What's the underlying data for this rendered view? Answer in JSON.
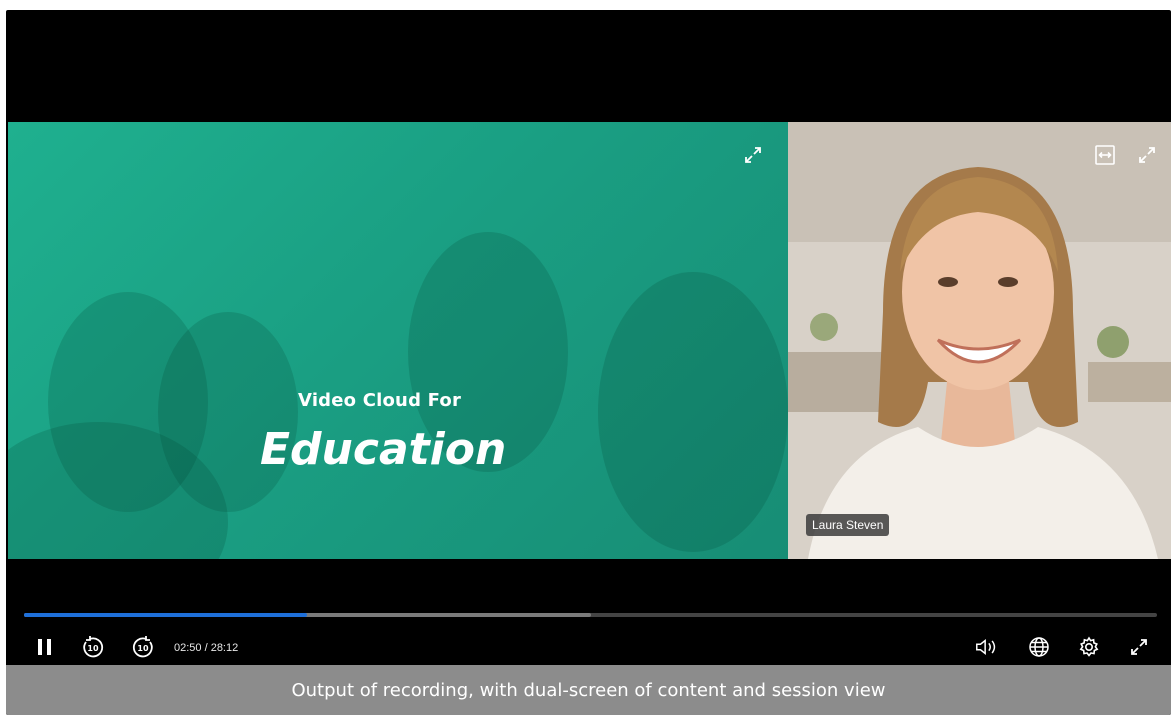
{
  "slide": {
    "title_small": "Video Cloud For",
    "title_large": "Education",
    "accent_color": "#1fb08f"
  },
  "session": {
    "presenter_name": "Laura Steven"
  },
  "player": {
    "current_time": "02:50",
    "total_time": "28:12",
    "time_display": "02:50 / 28:12",
    "played_fraction": 0.25,
    "buffered_fraction": 0.5,
    "progress_color": "#1e6fd9",
    "controls": {
      "pause": "pause-icon",
      "rewind": "rewind-10-icon",
      "forward": "forward-10-icon",
      "volume": "volume-icon",
      "language": "globe-icon",
      "settings": "gear-icon",
      "fullscreen": "fullscreen-icon"
    }
  },
  "caption": {
    "text": "Output of recording, with dual-screen of content and session view"
  }
}
